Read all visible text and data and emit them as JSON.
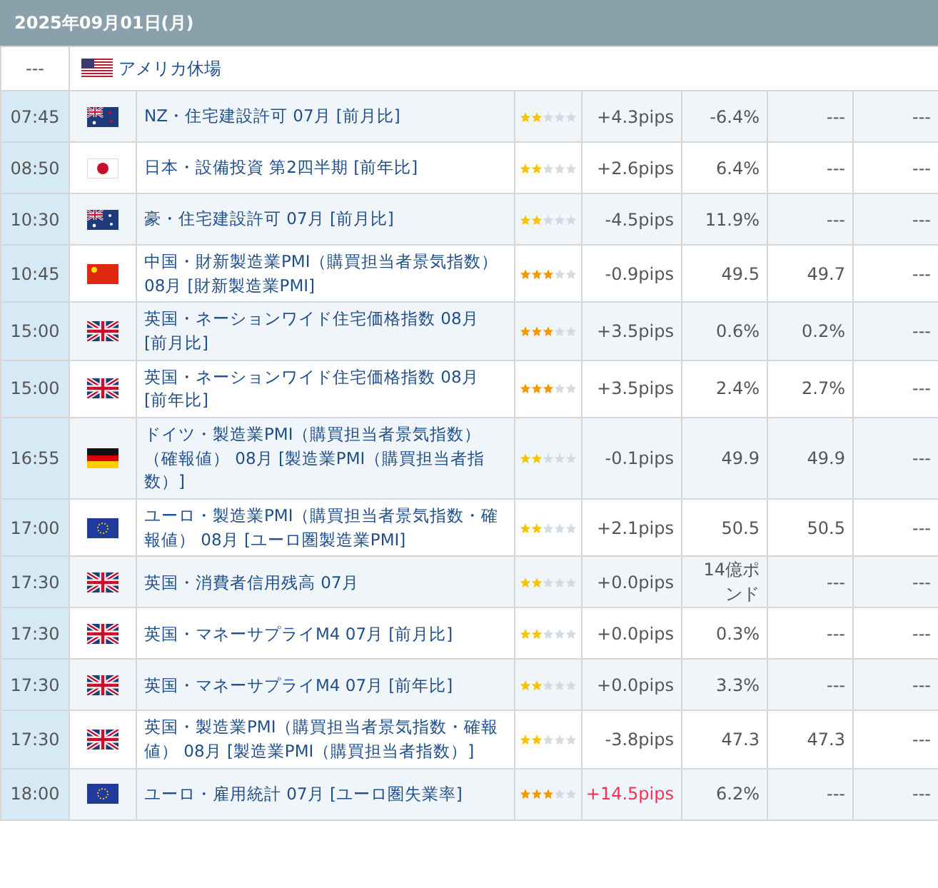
{
  "date": "2025年09月01日(月)",
  "holiday": {
    "time": "---",
    "kind": "us",
    "label": "アメリカ休場"
  },
  "events": [
    {
      "time": "07:45",
      "kind": "nz",
      "title": "NZ・住宅建設許可 07月 [前月比]",
      "stars": 2,
      "pips": "+4.3pips",
      "highlight": false,
      "column_6": "-6.4%",
      "column_7": "---",
      "column_8": "---"
    },
    {
      "time": "08:50",
      "kind": "jp",
      "title": "日本・設備投資 第2四半期 [前年比]",
      "stars": 2,
      "pips": "+2.6pips",
      "highlight": false,
      "column_6": "6.4%",
      "column_7": "---",
      "column_8": "---"
    },
    {
      "time": "10:30",
      "kind": "au",
      "title": "豪・住宅建設許可 07月 [前月比]",
      "stars": 2,
      "pips": "-4.5pips",
      "highlight": false,
      "column_6": "11.9%",
      "column_7": "---",
      "column_8": "---"
    },
    {
      "time": "10:45",
      "kind": "cn",
      "title": "中国・財新製造業PMI（購買担当者景気指数） 08月 [財新製造業PMI]",
      "stars": 3,
      "pips": "-0.9pips",
      "highlight": false,
      "column_6": "49.5",
      "column_7": "49.7",
      "column_8": "---"
    },
    {
      "time": "15:00",
      "kind": "gb",
      "title": "英国・ネーションワイド住宅価格指数 08月 [前月比]",
      "stars": 3,
      "pips": "+3.5pips",
      "highlight": false,
      "column_6": "0.6%",
      "column_7": "0.2%",
      "column_8": "---"
    },
    {
      "time": "15:00",
      "kind": "gb",
      "title": "英国・ネーションワイド住宅価格指数 08月 [前年比]",
      "stars": 3,
      "pips": "+3.5pips",
      "highlight": false,
      "column_6": "2.4%",
      "column_7": "2.7%",
      "column_8": "---"
    },
    {
      "time": "16:55",
      "kind": "de",
      "title": "ドイツ・製造業PMI（購買担当者景気指数）（確報値） 08月 [製造業PMI（購買担当者指数）]",
      "stars": 2,
      "pips": "-0.1pips",
      "highlight": false,
      "column_6": "49.9",
      "column_7": "49.9",
      "column_8": "---"
    },
    {
      "time": "17:00",
      "kind": "eu",
      "title": "ユーロ・製造業PMI（購買担当者景気指数・確報値） 08月 [ユーロ圏製造業PMI]",
      "stars": 2,
      "pips": "+2.1pips",
      "highlight": false,
      "column_6": "50.5",
      "column_7": "50.5",
      "column_8": "---"
    },
    {
      "time": "17:30",
      "kind": "gb",
      "title": "英国・消費者信用残高 07月",
      "stars": 2,
      "pips": "+0.0pips",
      "highlight": false,
      "column_6": "14億ポンド",
      "column_7": "---",
      "column_8": "---"
    },
    {
      "time": "17:30",
      "kind": "gb",
      "title": "英国・マネーサプライM4 07月 [前月比]",
      "stars": 2,
      "pips": "+0.0pips",
      "highlight": false,
      "column_6": "0.3%",
      "column_7": "---",
      "column_8": "---"
    },
    {
      "time": "17:30",
      "kind": "gb",
      "title": "英国・マネーサプライM4 07月 [前年比]",
      "stars": 2,
      "pips": "+0.0pips",
      "highlight": false,
      "column_6": "3.3%",
      "column_7": "---",
      "column_8": "---"
    },
    {
      "time": "17:30",
      "kind": "gb",
      "title": "英国・製造業PMI（購買担当者景気指数・確報値） 08月 [製造業PMI（購買担当者指数）]",
      "stars": 2,
      "pips": "-3.8pips",
      "highlight": false,
      "column_6": "47.3",
      "column_7": "47.3",
      "column_8": "---"
    },
    {
      "time": "18:00",
      "kind": "eu",
      "title": "ユーロ・雇用統計 07月 [ユーロ圏失業率]",
      "stars": 3,
      "pips": "+14.5pips",
      "highlight": true,
      "column_6": "6.2%",
      "column_7": "---",
      "column_8": "---"
    }
  ]
}
